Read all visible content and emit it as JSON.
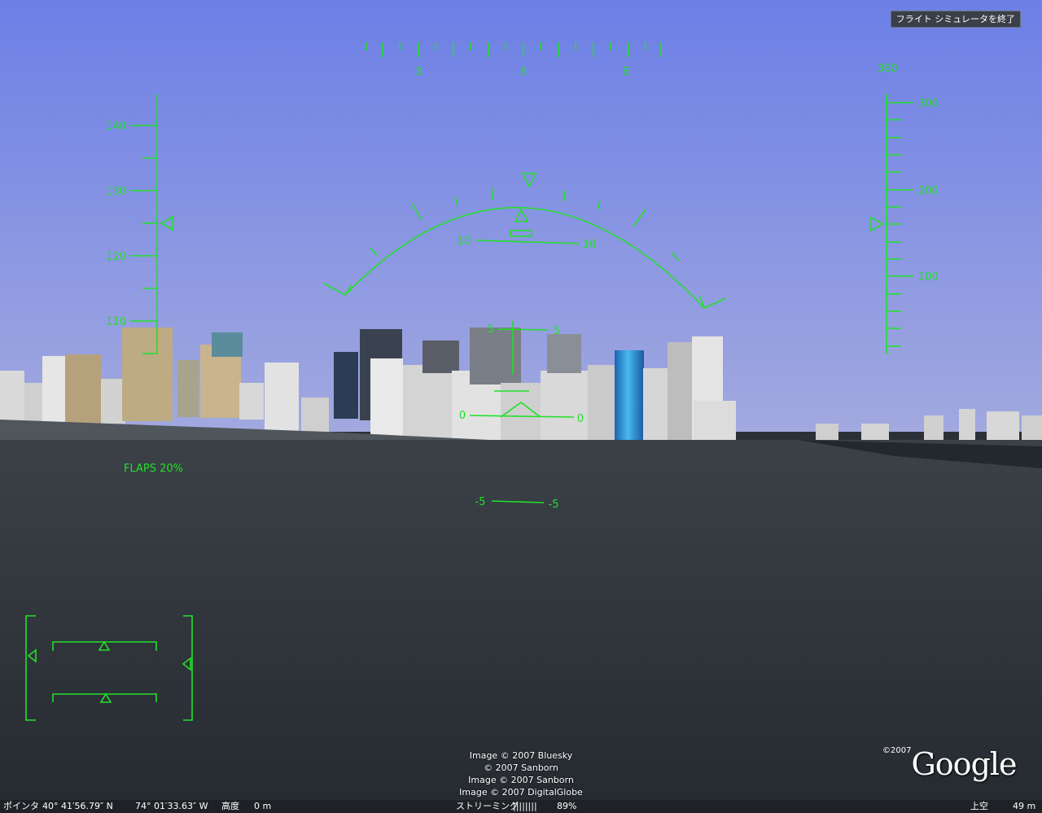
{
  "app": {
    "exit_label": "フライト シミュレータを終了"
  },
  "hud": {
    "heading_labels": [
      "3",
      "6",
      "E"
    ],
    "heading_bug": "360",
    "speed_labels": [
      "140",
      "130",
      "120",
      "110"
    ],
    "alt_labels": [
      "300",
      "200",
      "100"
    ],
    "pitch_labels": {
      "p10": "10",
      "p5": "5",
      "p0": "0",
      "m5": "-5"
    },
    "flaps": "FLAPS 20%"
  },
  "credits": [
    "Image © 2007 Bluesky",
    "© 2007 Sanborn",
    "Image © 2007 Sanborn",
    "Image © 2007 DigitalGlobe"
  ],
  "logo": {
    "year": "©2007",
    "text": "Google"
  },
  "status": {
    "pointer_label": "ポインタ",
    "lat": "40° 41′56.79″ N",
    "lon": "74° 01′33.63″ W",
    "elev_label": "高度",
    "elev": "0 m",
    "streaming_label": "ストリーミング",
    "streaming_bar": "||||||||",
    "streaming_pct": "89%",
    "sky_label": "上空",
    "sky_value": "49 m"
  },
  "colors": {
    "hud": "#22e02a",
    "sky_top": "#6c7fe6",
    "sky_bottom": "#a0a7df",
    "water": "#2b3036"
  }
}
